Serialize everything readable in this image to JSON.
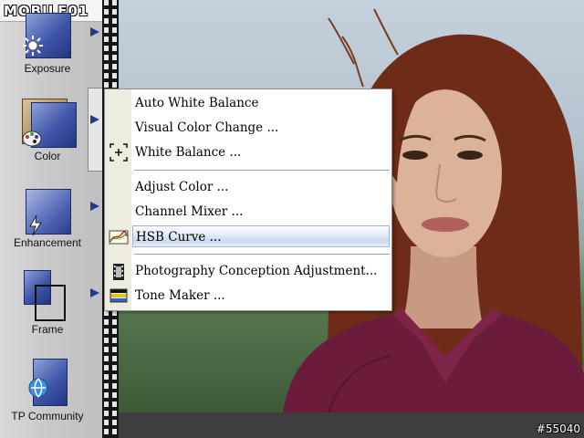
{
  "logo": {
    "text": "MOBILE01"
  },
  "watermark": {
    "id_text": "#55040"
  },
  "sidebar": {
    "tools": [
      {
        "label": "Exposure"
      },
      {
        "label": "Color"
      },
      {
        "label": "Enhancement"
      },
      {
        "label": "Frame"
      },
      {
        "label": "TP Community"
      }
    ]
  },
  "menu": {
    "items": [
      {
        "label": "Auto White Balance",
        "icon": "none"
      },
      {
        "label": "Visual Color Change ...",
        "icon": "none"
      },
      {
        "label": "White Balance ...",
        "icon": "target-icon"
      },
      {
        "label": "Adjust Color ...",
        "icon": "none"
      },
      {
        "label": "Channel Mixer ...",
        "icon": "none"
      },
      {
        "label": "HSB Curve ...",
        "icon": "hsb-curve-icon",
        "highlighted": true
      },
      {
        "label": "Photography Conception Adjustment...",
        "icon": "film-icon"
      },
      {
        "label": "Tone Maker ...",
        "icon": "tone-maker-icon"
      }
    ]
  },
  "colors": {
    "menu_highlight": "#c8d8ee",
    "menu_gutter": "#eeebdf",
    "tool_arrow": "#1f3b93",
    "tool_icon_blue": "#3f55a8"
  }
}
